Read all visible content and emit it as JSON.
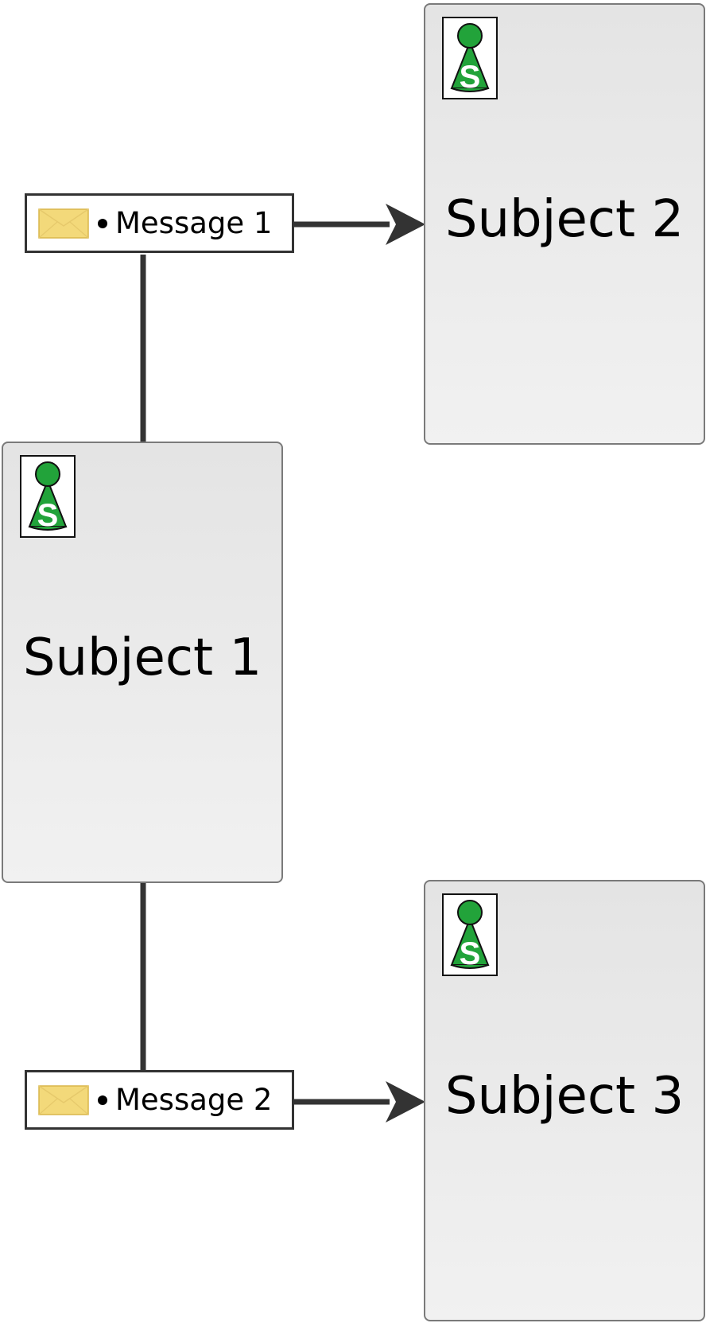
{
  "subjects": [
    {
      "label": "Subject 1",
      "icon": "subject-person-icon"
    },
    {
      "label": "Subject 2",
      "icon": "subject-person-icon"
    },
    {
      "label": "Subject 3",
      "icon": "subject-person-icon"
    }
  ],
  "messages": [
    {
      "label": "Message 1",
      "icon": "envelope-icon"
    },
    {
      "label": "Message 2",
      "icon": "envelope-icon"
    }
  ],
  "icon_letter": "S",
  "colors": {
    "subject_border": "#7a7a7a",
    "subject_fill_top": "#e4e4e4",
    "subject_fill_bottom": "#f1f1f1",
    "icon_green": "#22a33a",
    "envelope_fill": "#f3d97a",
    "connector": "#333333"
  }
}
